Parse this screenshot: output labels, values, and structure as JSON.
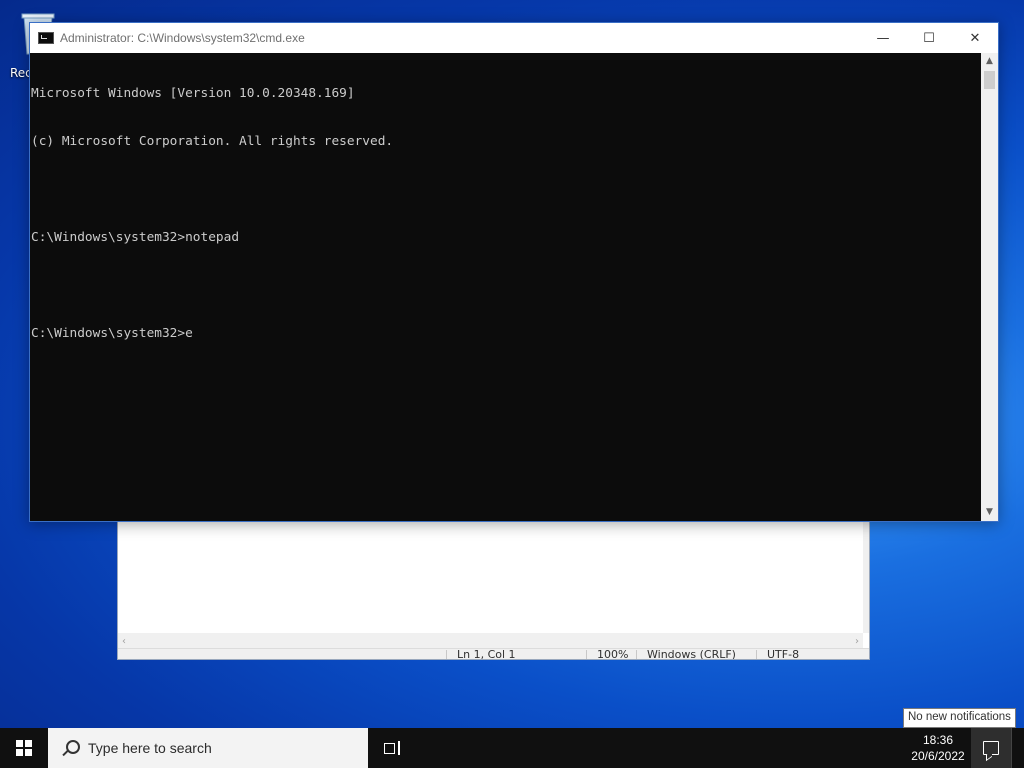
{
  "desktop": {
    "recycle_bin_label": "Rec"
  },
  "cmd_window": {
    "title": "Administrator: C:\\Windows\\system32\\cmd.exe",
    "lines": [
      "Microsoft Windows [Version 10.0.20348.169]",
      "(c) Microsoft Corporation. All rights reserved.",
      "",
      "C:\\Windows\\system32>notepad",
      "",
      "C:\\Windows\\system32>e"
    ],
    "minimize_glyph": "—",
    "maximize_glyph": "☐",
    "close_glyph": "✕"
  },
  "notepad_window": {
    "status": {
      "position": "Ln 1, Col 1",
      "zoom": "100%",
      "line_ending": "Windows (CRLF)",
      "encoding": "UTF-8"
    }
  },
  "taskbar": {
    "search_placeholder": "Type here to search",
    "time": "18:36",
    "date": "20/6/2022"
  },
  "tooltip": {
    "text": "No new notifications"
  }
}
